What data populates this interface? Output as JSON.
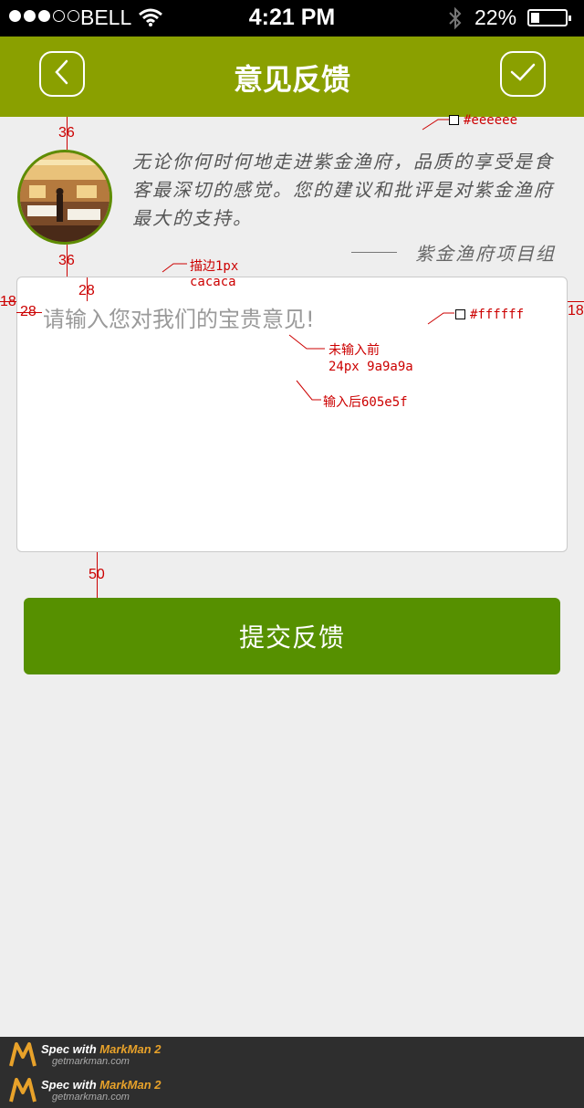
{
  "status_bar": {
    "carrier": "BELL",
    "time": "4:21 PM",
    "battery": "22%",
    "signal_dots_filled": 3,
    "signal_dots_total": 5,
    "battery_level": 0.22
  },
  "nav": {
    "title": "意见反馈",
    "back_icon": "chevron-left-icon",
    "confirm_icon": "checkmark-icon",
    "background_color": "#8aa000"
  },
  "intro": {
    "text": "无论你何时何地走进紫金渔府，品质的享受是食客最深切的感觉。您的建议和批评是对紫金渔府最大的支持。",
    "signature": "紫金渔府项目组"
  },
  "feedback": {
    "placeholder": "请输入您对我们的宝贵意见!",
    "value": ""
  },
  "submit": {
    "label": "提交反馈",
    "color": "#569000"
  },
  "annotations": {
    "bg_color": "#eeeeee",
    "box_color": "#ffffff",
    "stroke_label": "描边1px",
    "stroke_color": "cacaca",
    "before_label": "未输入前",
    "before_spec": "24px 9a9a9a",
    "after_label": "输入后605e5f",
    "dim_36a": "36",
    "dim_36b": "36",
    "dim_28_top": "28",
    "dim_28_left": "28",
    "dim_18_left": "18",
    "dim_18_right": "18",
    "dim_50": "50"
  },
  "footer": {
    "line1_prefix": "Spec with ",
    "line1_brand": "MarkMan 2",
    "line2": "getmarkman.com"
  }
}
